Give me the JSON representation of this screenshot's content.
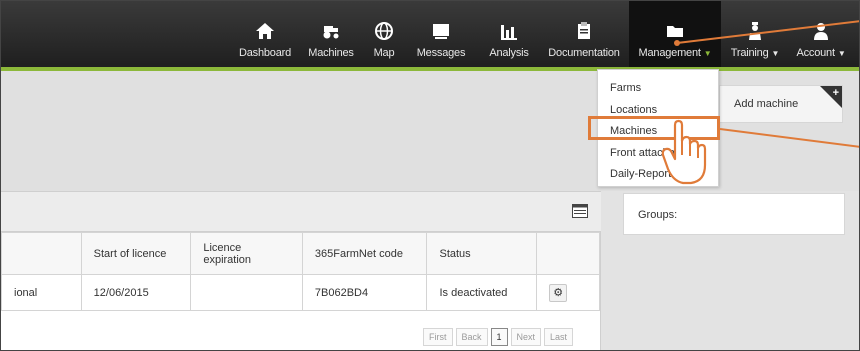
{
  "nav": {
    "items": [
      {
        "label": "Dashboard",
        "icon": "home-icon"
      },
      {
        "label": "Machines",
        "icon": "tractor-icon"
      },
      {
        "label": "Map",
        "icon": "globe-icon"
      },
      {
        "label": "Messages",
        "icon": "message-icon"
      },
      {
        "label": "Analysis",
        "icon": "bar-chart-icon"
      },
      {
        "label": "Documentation",
        "icon": "clipboard-icon"
      },
      {
        "label": "Management",
        "icon": "folder-icon"
      },
      {
        "label": "Training",
        "icon": "trainer-icon"
      },
      {
        "label": "Account",
        "icon": "user-icon"
      }
    ],
    "caret": "▼"
  },
  "management_menu": {
    "items": [
      "Farms",
      "Locations",
      "Machines",
      "Front attachments",
      "Daily-Reports"
    ],
    "highlighted": "Machines"
  },
  "add_machine": {
    "label": "Add machine",
    "plus": "+"
  },
  "groups": {
    "label": "Groups:"
  },
  "table": {
    "headers": [
      "",
      "Start of licence",
      "Licence expiration",
      "365FarmNet code",
      "Status",
      ""
    ],
    "rows": [
      [
        "ional",
        "12/06/2015",
        "",
        "7B062BD4",
        "Is deactivated",
        "⚙"
      ]
    ]
  },
  "pager": {
    "first": "First",
    "back": "Back",
    "current": "1",
    "next": "Next",
    "last": "Last"
  },
  "colors": {
    "accent": "#8cb83a",
    "annotation": "#e07b39",
    "nav_bg": "#2a2a2a"
  }
}
